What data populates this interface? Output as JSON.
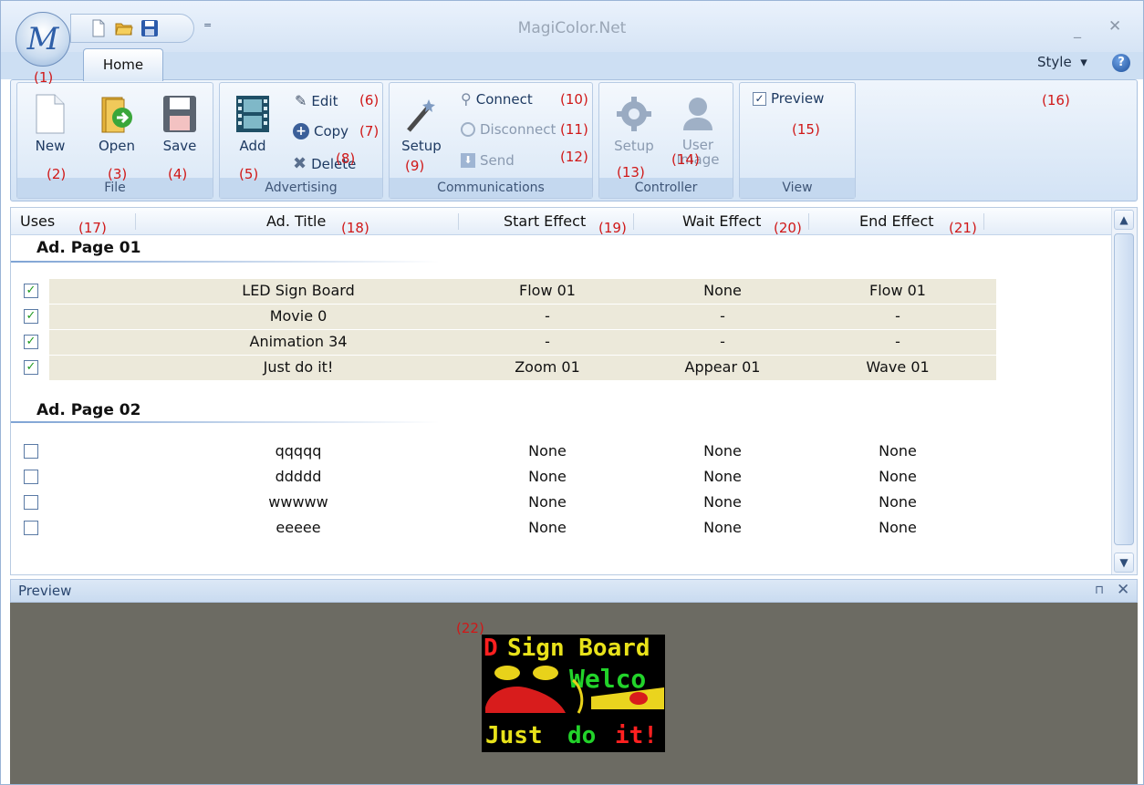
{
  "app": {
    "title": "MagiColor.Net",
    "orb_letter": "M"
  },
  "qat": {
    "new_icon": "new-document-icon",
    "open_icon": "open-folder-icon",
    "save_icon": "floppy-save-icon",
    "more": "="
  },
  "tabs": [
    {
      "label": "Home",
      "active": true
    }
  ],
  "style_menu": {
    "label": "Style",
    "arrow": "▾",
    "help": "?"
  },
  "ribbon": {
    "groups": {
      "file": {
        "label": "File",
        "new": "New",
        "open": "Open",
        "save": "Save"
      },
      "advertising": {
        "label": "Advertising",
        "add": "Add",
        "edit": "Edit",
        "copy": "Copy",
        "delete": "Delete"
      },
      "communications": {
        "label": "Communications",
        "setup": "Setup",
        "connect": "Connect",
        "disconnect": "Disconnect",
        "send": "Send"
      },
      "controller": {
        "label": "Controller",
        "setup": "Setup",
        "user_image_line1": "User",
        "user_image_line2": "Image"
      },
      "view": {
        "label": "View",
        "preview": "Preview",
        "preview_checked": true
      }
    }
  },
  "grid": {
    "columns": {
      "uses": "Uses",
      "title": "Ad. Title",
      "start": "Start Effect",
      "wait": "Wait Effect",
      "end": "End Effect"
    },
    "pages": [
      {
        "name": "Ad. Page 01",
        "rows": [
          {
            "checked": true,
            "title": "LED Sign Board",
            "start": "Flow 01",
            "wait": "None",
            "end": "Flow 01"
          },
          {
            "checked": true,
            "title": "Movie 0",
            "start": "-",
            "wait": "-",
            "end": "-"
          },
          {
            "checked": true,
            "title": "Animation 34",
            "start": "-",
            "wait": "-",
            "end": "-"
          },
          {
            "checked": true,
            "title": "Just do it!",
            "start": "Zoom 01",
            "wait": "Appear 01",
            "end": "Wave 01"
          }
        ]
      },
      {
        "name": "Ad. Page 02",
        "rows": [
          {
            "checked": false,
            "title": "qqqqq",
            "start": "None",
            "wait": "None",
            "end": "None"
          },
          {
            "checked": false,
            "title": "ddddd",
            "start": "None",
            "wait": "None",
            "end": "None"
          },
          {
            "checked": false,
            "title": "wwwww",
            "start": "None",
            "wait": "None",
            "end": "None"
          },
          {
            "checked": false,
            "title": "eeeee",
            "start": "None",
            "wait": "None",
            "end": "None"
          }
        ]
      }
    ]
  },
  "preview": {
    "title": "Preview",
    "pin": "⊓",
    "close": "✕",
    "led_lines": {
      "line1_red": "D",
      "line1_yellow": "Sign Board",
      "line2": "Welco",
      "line4_yellow": "Just",
      "line4_green": "do",
      "line4_red": "it!"
    }
  },
  "annotations": [
    "(1)",
    "(2)",
    "(3)",
    "(4)",
    "(5)",
    "(6)",
    "(7)",
    "(8)",
    "(9)",
    "(10)",
    "(11)",
    "(12)",
    "(13)",
    "(14)",
    "(15)",
    "(16)",
    "(17)",
    "(18)",
    "(19)",
    "(20)",
    "(21)",
    "(22)"
  ],
  "colors": {
    "annotation": "#d01818",
    "ribbon": "#d3e3f5",
    "selected_row": "#ece9da",
    "preview_bg": "#6c6b63"
  }
}
